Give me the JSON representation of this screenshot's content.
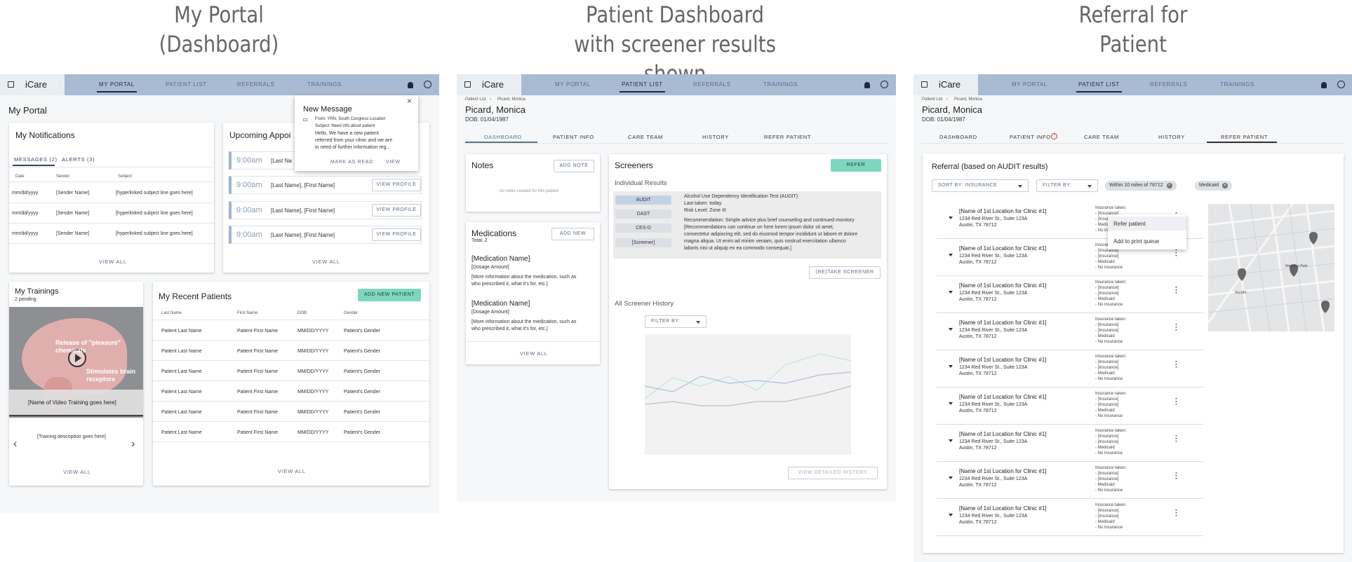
{
  "panel_titles": [
    {
      "line1": "My Portal",
      "line2": "(Dashboard)"
    },
    {
      "line1": "Patient Dashboard",
      "line2": "with screener results shown"
    },
    {
      "line1": "Referral for",
      "line2": "Patient"
    }
  ],
  "app": {
    "brand": "iCare",
    "nav": [
      "MY PORTAL",
      "PATIENT LIST",
      "REFERRALS",
      "TRAININGS"
    ]
  },
  "portal": {
    "page_title": "My Portal",
    "notifications": {
      "title": "My Notifications",
      "tabs": [
        "MESSAGES (2)",
        "ALERTS (3)"
      ],
      "headers": [
        "Date",
        "Sender",
        "Subject"
      ],
      "rows": [
        [
          "mm/dd/yyyy",
          "[Sender Name]",
          "[hyperlinked subject line goes here]"
        ],
        [
          "mm/dd/yyyy",
          "[Sender Name]",
          "[hyperlinked subject line goes here]"
        ],
        [
          "mm/dd/yyyy",
          "[Sender Name]",
          "[hyperlinked subject line goes here]"
        ]
      ],
      "view_all": "VIEW ALL"
    },
    "appointments": {
      "title": "Upcoming Appoi",
      "items": [
        {
          "time": "9:00am",
          "name": "[Last Na",
          "btn": ""
        },
        {
          "time": "9:00am",
          "name": "[Last Name], [First Name]",
          "btn": "VIEW PROFILE"
        },
        {
          "time": "9:00am",
          "name": "[Last Name], [First Name]",
          "btn": "VIEW PROFILE"
        },
        {
          "time": "9:00am",
          "name": "[Last Name], [First Name]",
          "btn": "VIEW PROFILE"
        }
      ],
      "view_all": "VIEW ALL"
    },
    "popup": {
      "title": "New Message",
      "from": "From: YRN, South Congress Location",
      "subject": "Subject: Need info about patient",
      "body1": "Hello, We have a new patient",
      "body2": "referred from your clinic and we are",
      "body3": "in need of further information reg...",
      "mark": "MARK AS READ",
      "view": "VIEW",
      "close": "×"
    },
    "trainings": {
      "title": "My Trainings",
      "pending": "2 pending",
      "overlay1": "Release of \"pleasure\"",
      "overlay2": "chemicals",
      "overlay3": "Stimulates brain",
      "overlay4": "receptors",
      "video_name": "[Name of Video Training goes here]",
      "desc": "[Training description goes here]",
      "view_all": "VIEW ALL"
    },
    "recent": {
      "title": "My Recent Patients",
      "add_btn": "ADD NEW PATIENT",
      "headers": [
        "Last Name",
        "First Name",
        "DOB",
        "Gender"
      ],
      "rows": [
        [
          "Patient Last Name",
          "Patient First Name",
          "MM/DD/YYYY",
          "Patient's Gender"
        ],
        [
          "Patient Last Name",
          "Patient First Name",
          "MM/DD/YYYY",
          "Patient's Gender"
        ],
        [
          "Patient Last Name",
          "Patient First Name",
          "MM/DD/YYYY",
          "Patient's Gender"
        ],
        [
          "Patient Last Name",
          "Patient First Name",
          "MM/DD/YYYY",
          "Patient's Gender"
        ],
        [
          "Patient Last Name",
          "Patient First Name",
          "MM/DD/YYYY",
          "Patient's Gender"
        ],
        [
          "Patient Last Name",
          "Patient First Name",
          "MM/DD/YYYY",
          "Patient's Gender"
        ]
      ],
      "view_all": "VIEW ALL"
    }
  },
  "patient": {
    "breadcrumb_root": "Patient List",
    "breadcrumb_current": "Picard, Monica",
    "name": "Picard, Monica",
    "dob": "DOB: 01/04/1987",
    "tabs": [
      "DASHBOARD",
      "PATIENT INFO",
      "CARE TEAM",
      "HISTORY",
      "REFER PATIENT"
    ],
    "notes": {
      "title": "Notes",
      "btn": "ADD NOTE",
      "empty": "no notes created for this patient"
    },
    "meds": {
      "title": "Medications",
      "total": "Total: 2",
      "btn": "ADD NEW",
      "items": [
        {
          "name": "[Medication Name]",
          "dose": "[Dosage Amount]",
          "info1": "[More information about the medication, such as",
          "info2": "who prescribed it, what it's for, etc.]"
        },
        {
          "name": "[Medication Name]",
          "dose": "[Dosage Amount]",
          "info1": "[More information about the medication, such as",
          "info2": "who prescribed it, what it's for, etc.]"
        }
      ],
      "view_all": "VIEW ALL"
    },
    "screeners": {
      "title": "Screeners",
      "refer_btn": "REFER",
      "individual": "Individual Results",
      "buttons": [
        "AUDIT",
        "DAST",
        "CES-D",
        "[Screener]"
      ],
      "result_title": "Alcohol Use Dependency Identification Test (AUDIT)",
      "last_taken": "Last taken: today",
      "risk": "Risk Level: Zone III",
      "rec1": "Recommendation: Simple advice plus brief counseling and continued monitory",
      "rec2": "[Recommendations can continue on here lorem ipsum dolor sit amet,",
      "rec3": "consectetur adipiscing elit, sed do eiusmod tempor incididunt ut labore et dolore",
      "rec4": "magna aliqua. Ut enim ad minim veniam, quis nostrud exercitation ullamco",
      "rec5": "laboris nisi ut aliquip ex ea commodo consequat.]",
      "retake": "(RE)TAKE SCREENER",
      "history": "All Screener History",
      "filter": "FILTER BY:",
      "view_history": "VIEW DETAILED HISTORY"
    }
  },
  "referral": {
    "title": "Referral (based on AUDIT results)",
    "sort": "SORT BY: INSURANCE",
    "filter": "FILTER BY:",
    "chips": [
      "Within 10 miles of 78712",
      "Medicaid"
    ],
    "clinic_name": "[Name of 1st Location for Clinic #1]",
    "addr1": "1234 Red River St., Suite 123A",
    "addr2": "Austin, TX 78712",
    "ins": [
      "Insurance taken:",
      "- [Insurance]",
      "- [Insurance]",
      "- Medicaid",
      "- No insurance"
    ],
    "menu": [
      "Refer patient",
      "Add to print queue"
    ],
    "map_labels": [
      "Waterloo Park",
      "Austin"
    ]
  }
}
